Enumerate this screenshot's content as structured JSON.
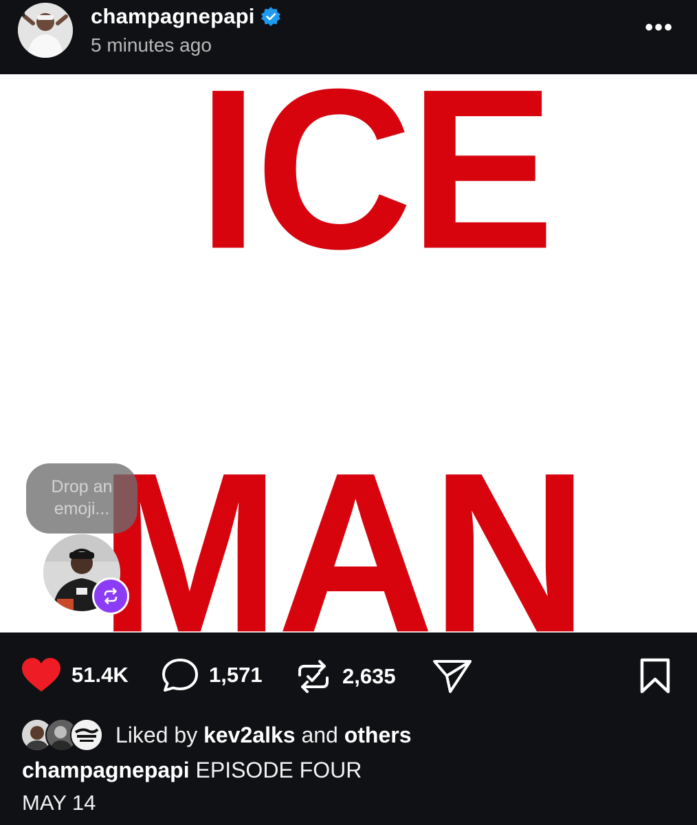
{
  "header": {
    "username": "champagnepapi",
    "timestamp": "5 minutes ago",
    "more_label": "•••"
  },
  "post": {
    "line1": "ICE",
    "line2": "MAN",
    "text_color": "#d7040e",
    "emoji_prompt_line1": "Drop an",
    "emoji_prompt_line2": "emoji..."
  },
  "actions": {
    "likes": "51.4K",
    "comments": "1,571",
    "reposts": "2,635",
    "like_color": "#ee1d25",
    "repost_badge_color": "#8b3cf5"
  },
  "liked_by": {
    "prefix": "Liked by",
    "user": "kev2alks",
    "joiner": "and",
    "others": "others"
  },
  "caption": {
    "username": "champagnepapi",
    "text": "EPISODE FOUR",
    "line2": "MAY 14"
  }
}
